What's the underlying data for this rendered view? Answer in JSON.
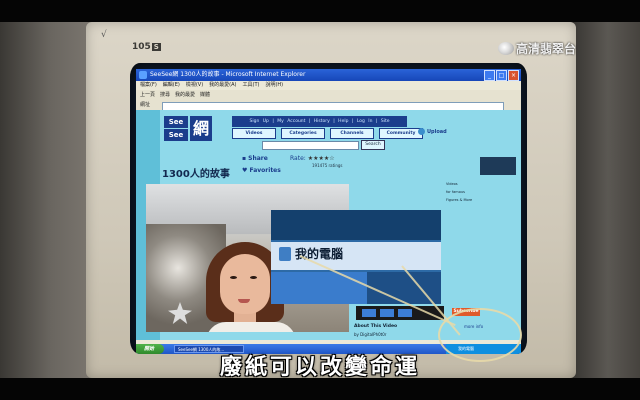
{
  "overlay_badge": {
    "text": "高清翡翠台"
  },
  "monitor": {
    "model": "105",
    "model_badge": "S",
    "corner_mark": "√"
  },
  "browser": {
    "title": "SeeSee網 1300人的故事 - Microsoft Internet Explorer",
    "menu": [
      "檔案(F)",
      "編輯(E)",
      "檢視(V)",
      "我的最愛(A)",
      "工具(T)",
      "說明(H)"
    ],
    "toolbar": [
      "上一頁",
      "搜尋",
      "我的最愛",
      "媒體"
    ],
    "address_label": "網址"
  },
  "site": {
    "logo_top": "See",
    "logo_bottom": "See",
    "logo_char": "網",
    "top_links": "Sign Up | My Account | History | Help | Log In | Site",
    "tabs": [
      "Videos",
      "Categories",
      "Channels",
      "Community"
    ],
    "upload": "Upload",
    "search_button": "Search",
    "video_title": "1300人的故事",
    "share": "Share",
    "rate_label": "Rate:",
    "rate_stars": "★★★★☆",
    "ratings_count": "191475 ratings",
    "favorites": "Favorites",
    "overlay_label": "我的電腦",
    "side_text": [
      "Videos",
      "for famous",
      "Figures & More",
      "quality"
    ],
    "advertisement": "Advertisement",
    "subscribe": "Subscribe",
    "about": "About This Video",
    "byline": "by DigitalPh0t0r",
    "more_info": "more info"
  },
  "taskbar": {
    "start": "開始",
    "item": "SeeSee網 1300人的故...",
    "tray_label": "我的電腦"
  },
  "subtitle": "廢紙可以改變命運"
}
